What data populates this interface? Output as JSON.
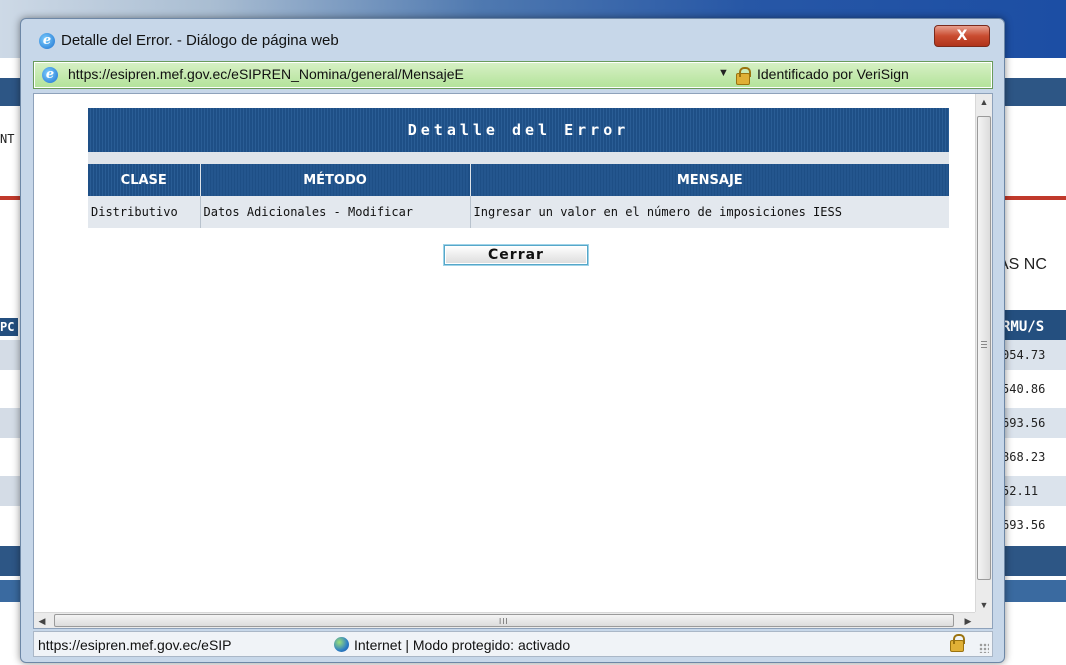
{
  "dialog": {
    "title": "Detalle del Error. - Diálogo de página web",
    "close_label": "X",
    "address_url": "https://esipren.mef.gov.ec/eSIPREN_Nomina/general/MensajeE",
    "address_dropdown": "▼",
    "certificate_text": "Identificado por VeriSign",
    "error_banner": "Detalle del Error",
    "table": {
      "headers": [
        "CLASE",
        "MÉTODO",
        "MENSAJE"
      ],
      "row": [
        "Distributivo",
        "Datos Adicionales - Modificar",
        "Ingresar un valor en el número de imposiciones IESS"
      ]
    },
    "close_button_label": "Cerrar",
    "status_url": "https://esipren.mef.gov.ec/eSIP",
    "status_zone": "Internet | Modo protegido: activado",
    "hscroll_grip": "III"
  },
  "background": {
    "left_fragment_nt": "NT",
    "left_fragment_pc": "PC",
    "heading_fragment": "AS NC",
    "column_header": "RMU/S",
    "column_values": [
      "054.73",
      "540.86",
      "693.56",
      "868.23",
      "52.11",
      "693.56"
    ]
  },
  "colors": {
    "banner_blue": "#1e4f86",
    "address_green": "#b4e39b",
    "close_red": "#c94c30"
  }
}
